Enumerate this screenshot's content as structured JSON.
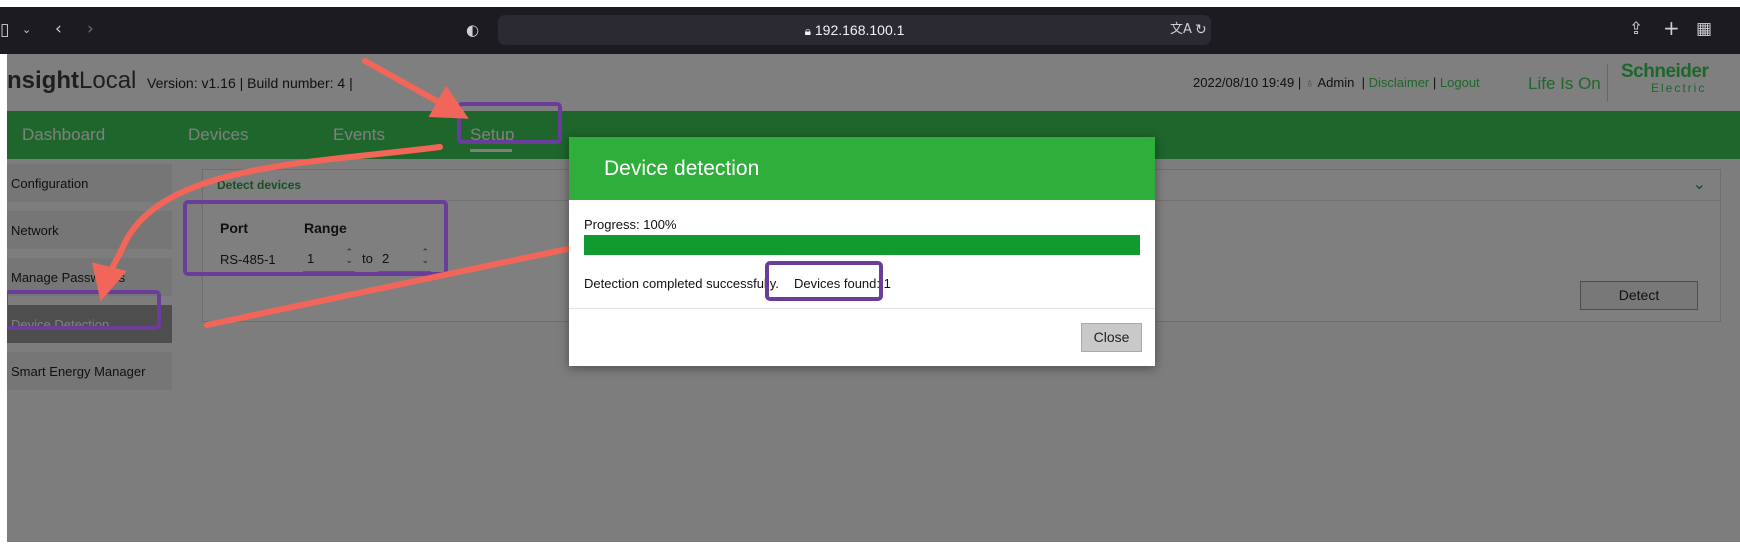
{
  "browser": {
    "url": "192.168.100.1",
    "icons": [
      "sidebar-icon",
      "chevron-down-icon",
      "back-icon",
      "forward-icon",
      "shield-icon",
      "lock-icon",
      "translate-icon",
      "reload-icon",
      "share-icon",
      "new-tab-icon",
      "tab-overview-icon"
    ]
  },
  "header": {
    "brand_part1": "nsight",
    "brand_part2": "Local",
    "version": "Version: v1.16 | Build number: 4 |",
    "datetime": "2022/08/10 19:49 |",
    "user": "Admin",
    "sep1": "|",
    "disclaimer": "Disclaimer",
    "sep2": "|",
    "logout": "Logout",
    "tagline": "Life Is On",
    "logo_line1": "Schneider",
    "logo_line2": "Electric"
  },
  "nav": {
    "items": [
      "Dashboard",
      "Devices",
      "Events",
      "Setup"
    ]
  },
  "sidebar": {
    "items": [
      "Configuration",
      "Network",
      "Manage Passwords",
      "Device Detection",
      "Smart Energy Manager"
    ],
    "active_index": 3
  },
  "panel": {
    "title": "Detect devices",
    "port_header": "Port",
    "range_header": "Range",
    "port": "RS-485-1",
    "range_from": "1",
    "range_to_label": "to",
    "range_to": "2",
    "detect_button": "Detect"
  },
  "modal": {
    "title": "Device detection",
    "progress_label": "Progress: 100%",
    "progress_value": 1.0,
    "message": "Detection completed successfully.",
    "devices_found": "Devices found: 1",
    "close_button": "Close"
  },
  "colors": {
    "brand_green": "#3dcd58",
    "modal_header": "#2fae3b",
    "progress_fill": "#119a2e",
    "annotation_box": "#6a3d9a",
    "annotation_arrow": "#f2665a"
  }
}
